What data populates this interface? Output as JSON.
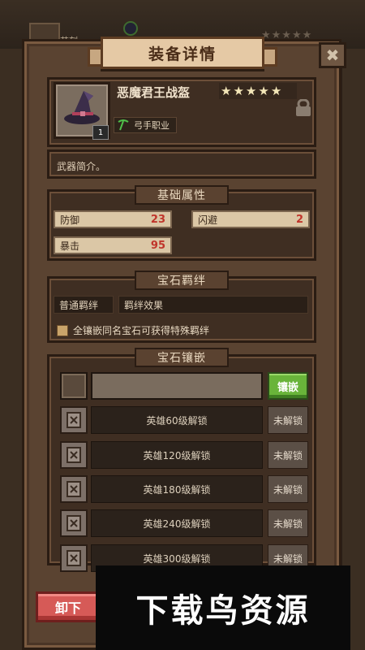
{
  "background": {
    "player_name": "芯刻",
    "rating_stars": "★★★★★"
  },
  "dialog": {
    "title": "装备详情",
    "close_label": "✖"
  },
  "item": {
    "name": "恶魔君王战盔",
    "stars": [
      "★",
      "★",
      "★",
      "★",
      "★"
    ],
    "level_badge": "1",
    "class_label": "弓手职业",
    "intro": "武器简介。",
    "icon": "witch-hat-icon"
  },
  "base_attributes": {
    "title": "基础属性",
    "items": [
      {
        "label": "防御",
        "value": "23"
      },
      {
        "label": "闪避",
        "value": "2"
      },
      {
        "label": "暴击",
        "value": "95"
      }
    ]
  },
  "gem_bond": {
    "title": "宝石羁绊",
    "type_label": "普通羁绊",
    "effect_label": "羁绊效果",
    "note": "全镶嵌同名宝石可获得特殊羁绊"
  },
  "gem_inlay": {
    "title": "宝石镶嵌",
    "inlay_button": "镶嵌",
    "slots": [
      {
        "label": "英雄60级解锁",
        "status": "未解锁"
      },
      {
        "label": "英雄120级解锁",
        "status": "未解锁"
      },
      {
        "label": "英雄180级解锁",
        "status": "未解锁"
      },
      {
        "label": "英雄240级解锁",
        "status": "未解锁"
      },
      {
        "label": "英雄300级解锁",
        "status": "未解锁"
      }
    ]
  },
  "actions": {
    "unequip_label": "卸下"
  },
  "watermark": {
    "text": "下载鸟资源"
  },
  "colors": {
    "accent_green": "#69b43a",
    "value_red": "#c0352b",
    "unequip_red": "#d65a57"
  }
}
